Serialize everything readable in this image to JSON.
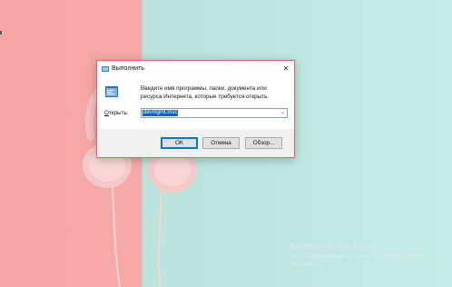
{
  "dialog": {
    "title": "Выполнить",
    "close_glyph": "✕",
    "description": "Введите имя программы, папки, документа или ресурса Интернета, которые требуется открыть.",
    "open_label_prefix": "О",
    "open_label_rest": "ткрыть:",
    "combo_value": "devmgmt.msc",
    "combo_arrow": "⌄",
    "ok_label": "OK",
    "cancel_label": "Отмена",
    "browse_label": "Обзор..."
  },
  "watermark": {
    "title": "Активация Windows",
    "subtitle": "Чтобы активировать Windows, перейдите в раздел \"Параметры\"."
  },
  "colors": {
    "accent": "#0078d7",
    "dialog_border": "#e06666",
    "selection": "#0a63c8",
    "background_left": "#f5a6a4",
    "background_right": "#c5ebe5"
  },
  "icons": [
    "run-dialog-icon",
    "run-program-icon",
    "close-icon",
    "dropdown-arrow-icon"
  ]
}
